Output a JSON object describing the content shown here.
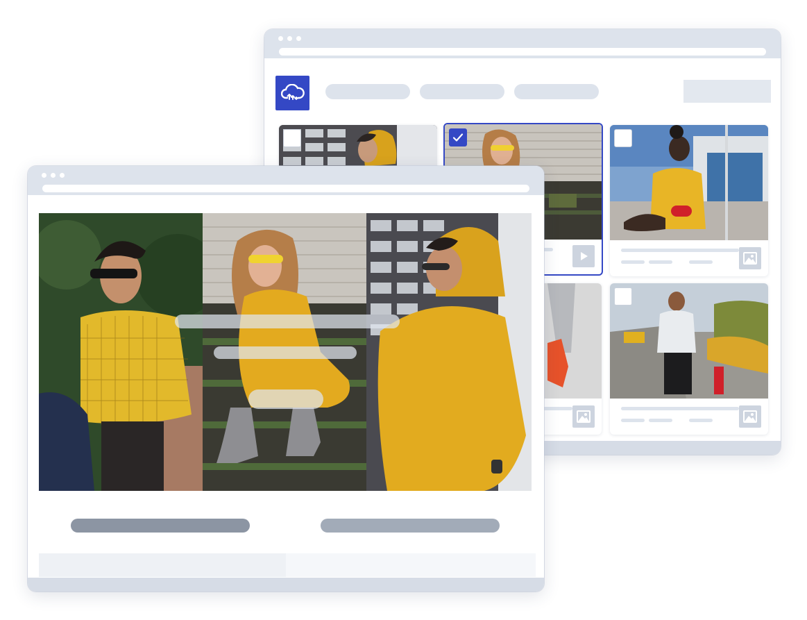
{
  "colors": {
    "accent": "#3448c5",
    "chrome": "#dde3ec",
    "placeholder_bar": "#dde3ec",
    "caption_dark": "#8c95a3",
    "caption_light": "#a2abb8",
    "mustard": "#e0a81f"
  },
  "back_window": {
    "logo_icon": "cloud-upload-icon",
    "nav_pills": 3,
    "cards": [
      {
        "state": "unchecked",
        "media": "image",
        "subject": "man-yellow-hoodie-building"
      },
      {
        "state": "checked",
        "media": "video",
        "subject": "woman-yellow-dress-sunglasses",
        "check_icon": "checkmark-icon",
        "type_icon": "play-icon"
      },
      {
        "state": "unchecked",
        "media": "image",
        "subject": "woman-floral-yellow-dress",
        "type_icon": "image-icon"
      },
      {
        "state": "unchecked",
        "media": "image",
        "subject": "partial-red-shoes"
      },
      {
        "state": "partial",
        "media": "image",
        "subject": "partial-grey-pants"
      },
      {
        "state": "unchecked",
        "media": "image",
        "subject": "man-white-sweater-street",
        "type_icon": "image-icon"
      }
    ]
  },
  "front_window": {
    "hero_panels": [
      {
        "subject": "man-yellow-checked-shirt"
      },
      {
        "subject": "woman-yellow-dress-stairs"
      },
      {
        "subject": "man-yellow-hoodie"
      }
    ]
  }
}
